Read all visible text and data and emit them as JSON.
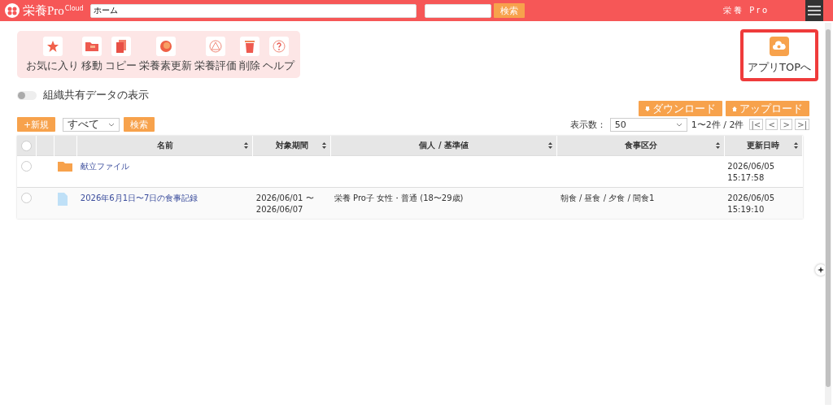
{
  "header": {
    "logo_text": "栄養Pro",
    "logo_sup": "Cloud",
    "search_value": "ホーム",
    "search_button": "検索",
    "user": "栄養 Pro"
  },
  "toolbar": [
    {
      "kind": "star",
      "label": "お気に入り"
    },
    {
      "kind": "move",
      "label": "移動"
    },
    {
      "kind": "copy",
      "label": "コピー"
    },
    {
      "kind": "update",
      "label": "栄養素更新"
    },
    {
      "kind": "eval",
      "label": "栄養評価"
    },
    {
      "kind": "trash",
      "label": "削除"
    },
    {
      "kind": "help",
      "label": "ヘルプ"
    }
  ],
  "app_top": {
    "label": "アプリTOPへ"
  },
  "share_toggle": {
    "label": "組織共有データの表示",
    "on": false
  },
  "actions": [
    "ダウンロード",
    "アップロード"
  ],
  "filter": {
    "new_button": "+新規",
    "select_value": "すべて",
    "search_button": "検索"
  },
  "paging": {
    "label": "表示数：",
    "page_size": "50",
    "range": "1〜2件 / 2件",
    "buttons": [
      "|<",
      "<",
      ">",
      ">|"
    ]
  },
  "table": {
    "all_selected": false,
    "columns": [
      {
        "label": "名前",
        "sortable": true
      },
      {
        "label": "対象期間",
        "sortable": true
      },
      {
        "label": "個人 / 基準値",
        "sortable": true
      },
      {
        "label": "食事区分",
        "sortable": true
      },
      {
        "label": "更新日時",
        "sortable": true
      }
    ],
    "rows": [
      {
        "kind": "folder",
        "selected": false,
        "name": "献立ファイル",
        "updated": "2026/06/05 15:17:58"
      },
      {
        "kind": "file",
        "selected": false,
        "name": "2026年6月1日〜7日の食事記録",
        "period": "2026/06/01 〜 2026/06/07",
        "person": "栄養 Pro子 女性・普通 (18〜29歳)",
        "meal": "朝食 / 昼食 / 夕食 / 間食1",
        "updated": "2026/06/05 15:19:10"
      }
    ]
  }
}
